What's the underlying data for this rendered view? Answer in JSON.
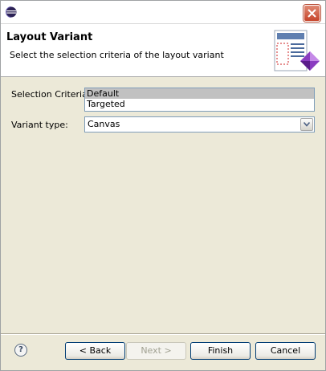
{
  "window": {
    "app_icon": "eclipse-icon",
    "close_icon": "close-icon"
  },
  "banner": {
    "title": "Layout Variant",
    "description": "Select the selection criteria of the layout variant",
    "image_icon": "wizard-layout-icon"
  },
  "form": {
    "selection_criteria_label": "Selection Criteria:",
    "selection_criteria_options": [
      "Default",
      "Targeted"
    ],
    "selection_criteria_selected": "Default",
    "variant_type_label": "Variant type:",
    "variant_type_value": "Canvas"
  },
  "footer": {
    "help_icon": "help-icon",
    "back_label": "< Back",
    "next_label": "Next >",
    "finish_label": "Finish",
    "cancel_label": "Cancel"
  }
}
